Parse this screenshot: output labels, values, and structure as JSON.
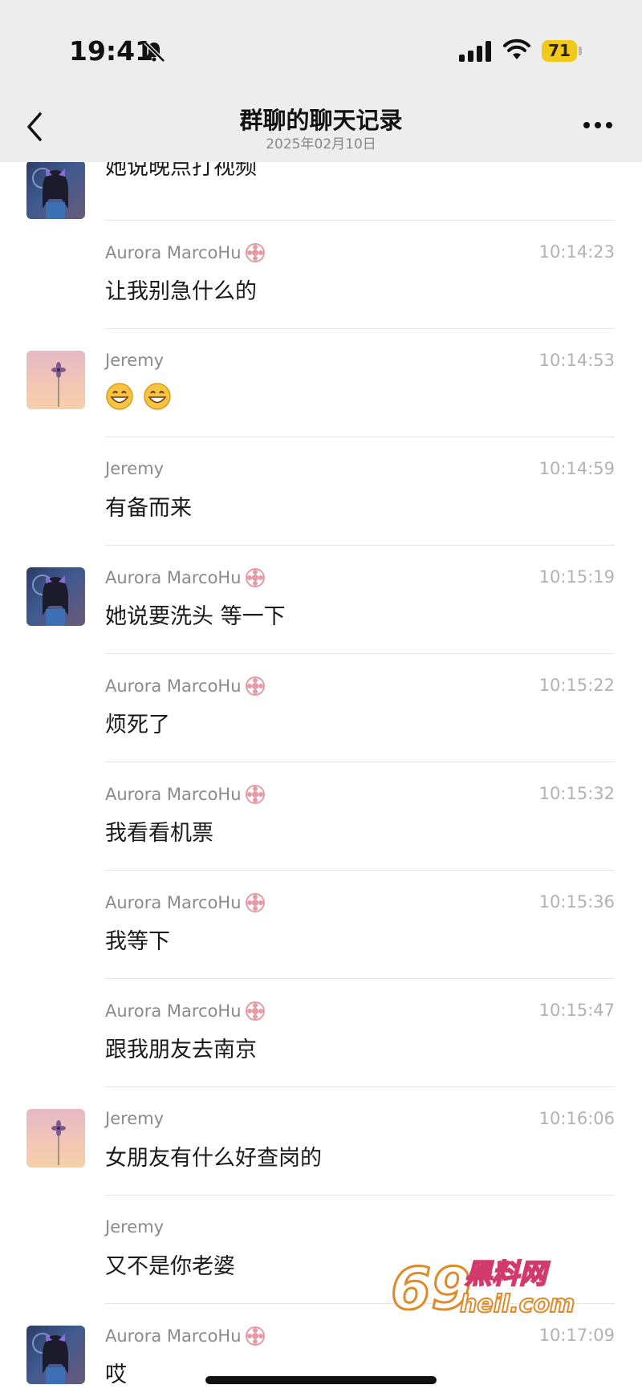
{
  "status_bar": {
    "time": "19:41",
    "battery": "71"
  },
  "nav": {
    "title": "群聊的聊天记录",
    "subtitle": "2025年02月10日"
  },
  "messages": [
    {
      "sender": "",
      "time": "",
      "text": "她说晚点打视频"
    },
    {
      "sender": "Aurora MarcoHu",
      "time": "10:14:23",
      "text": "让我别急什么的"
    },
    {
      "sender": "Jeremy",
      "time": "10:14:53",
      "text": ""
    },
    {
      "sender": "Jeremy",
      "time": "10:14:59",
      "text": "有备而来"
    },
    {
      "sender": "Aurora MarcoHu",
      "time": "10:15:19",
      "text": "她说要洗头 等一下"
    },
    {
      "sender": "Aurora MarcoHu",
      "time": "10:15:22",
      "text": "烦死了"
    },
    {
      "sender": "Aurora MarcoHu",
      "time": "10:15:32",
      "text": "我看看机票"
    },
    {
      "sender": "Aurora MarcoHu",
      "time": "10:15:36",
      "text": "我等下"
    },
    {
      "sender": "Aurora MarcoHu",
      "time": "10:15:47",
      "text": "跟我朋友去南京"
    },
    {
      "sender": "Jeremy",
      "time": "10:16:06",
      "text": "女朋友有什么好查岗的"
    },
    {
      "sender": "Jeremy",
      "time": "",
      "text": "又不是你老婆"
    },
    {
      "sender": "Aurora MarcoHu",
      "time": "10:17:09",
      "text": "哎"
    }
  ],
  "icons": {
    "mute": "bell-off-icon",
    "back": "chevron-left-icon",
    "more": "more-dots-icon",
    "badge": "flower-badge-icon",
    "emoji": "grinning-face-emoji"
  },
  "watermark": {
    "number": "69",
    "name": "黑料网",
    "domain": "heil.com"
  },
  "colors": {
    "header_bg": "#ededed",
    "battery": "#f2c81b",
    "badge": "#e59aa6"
  }
}
